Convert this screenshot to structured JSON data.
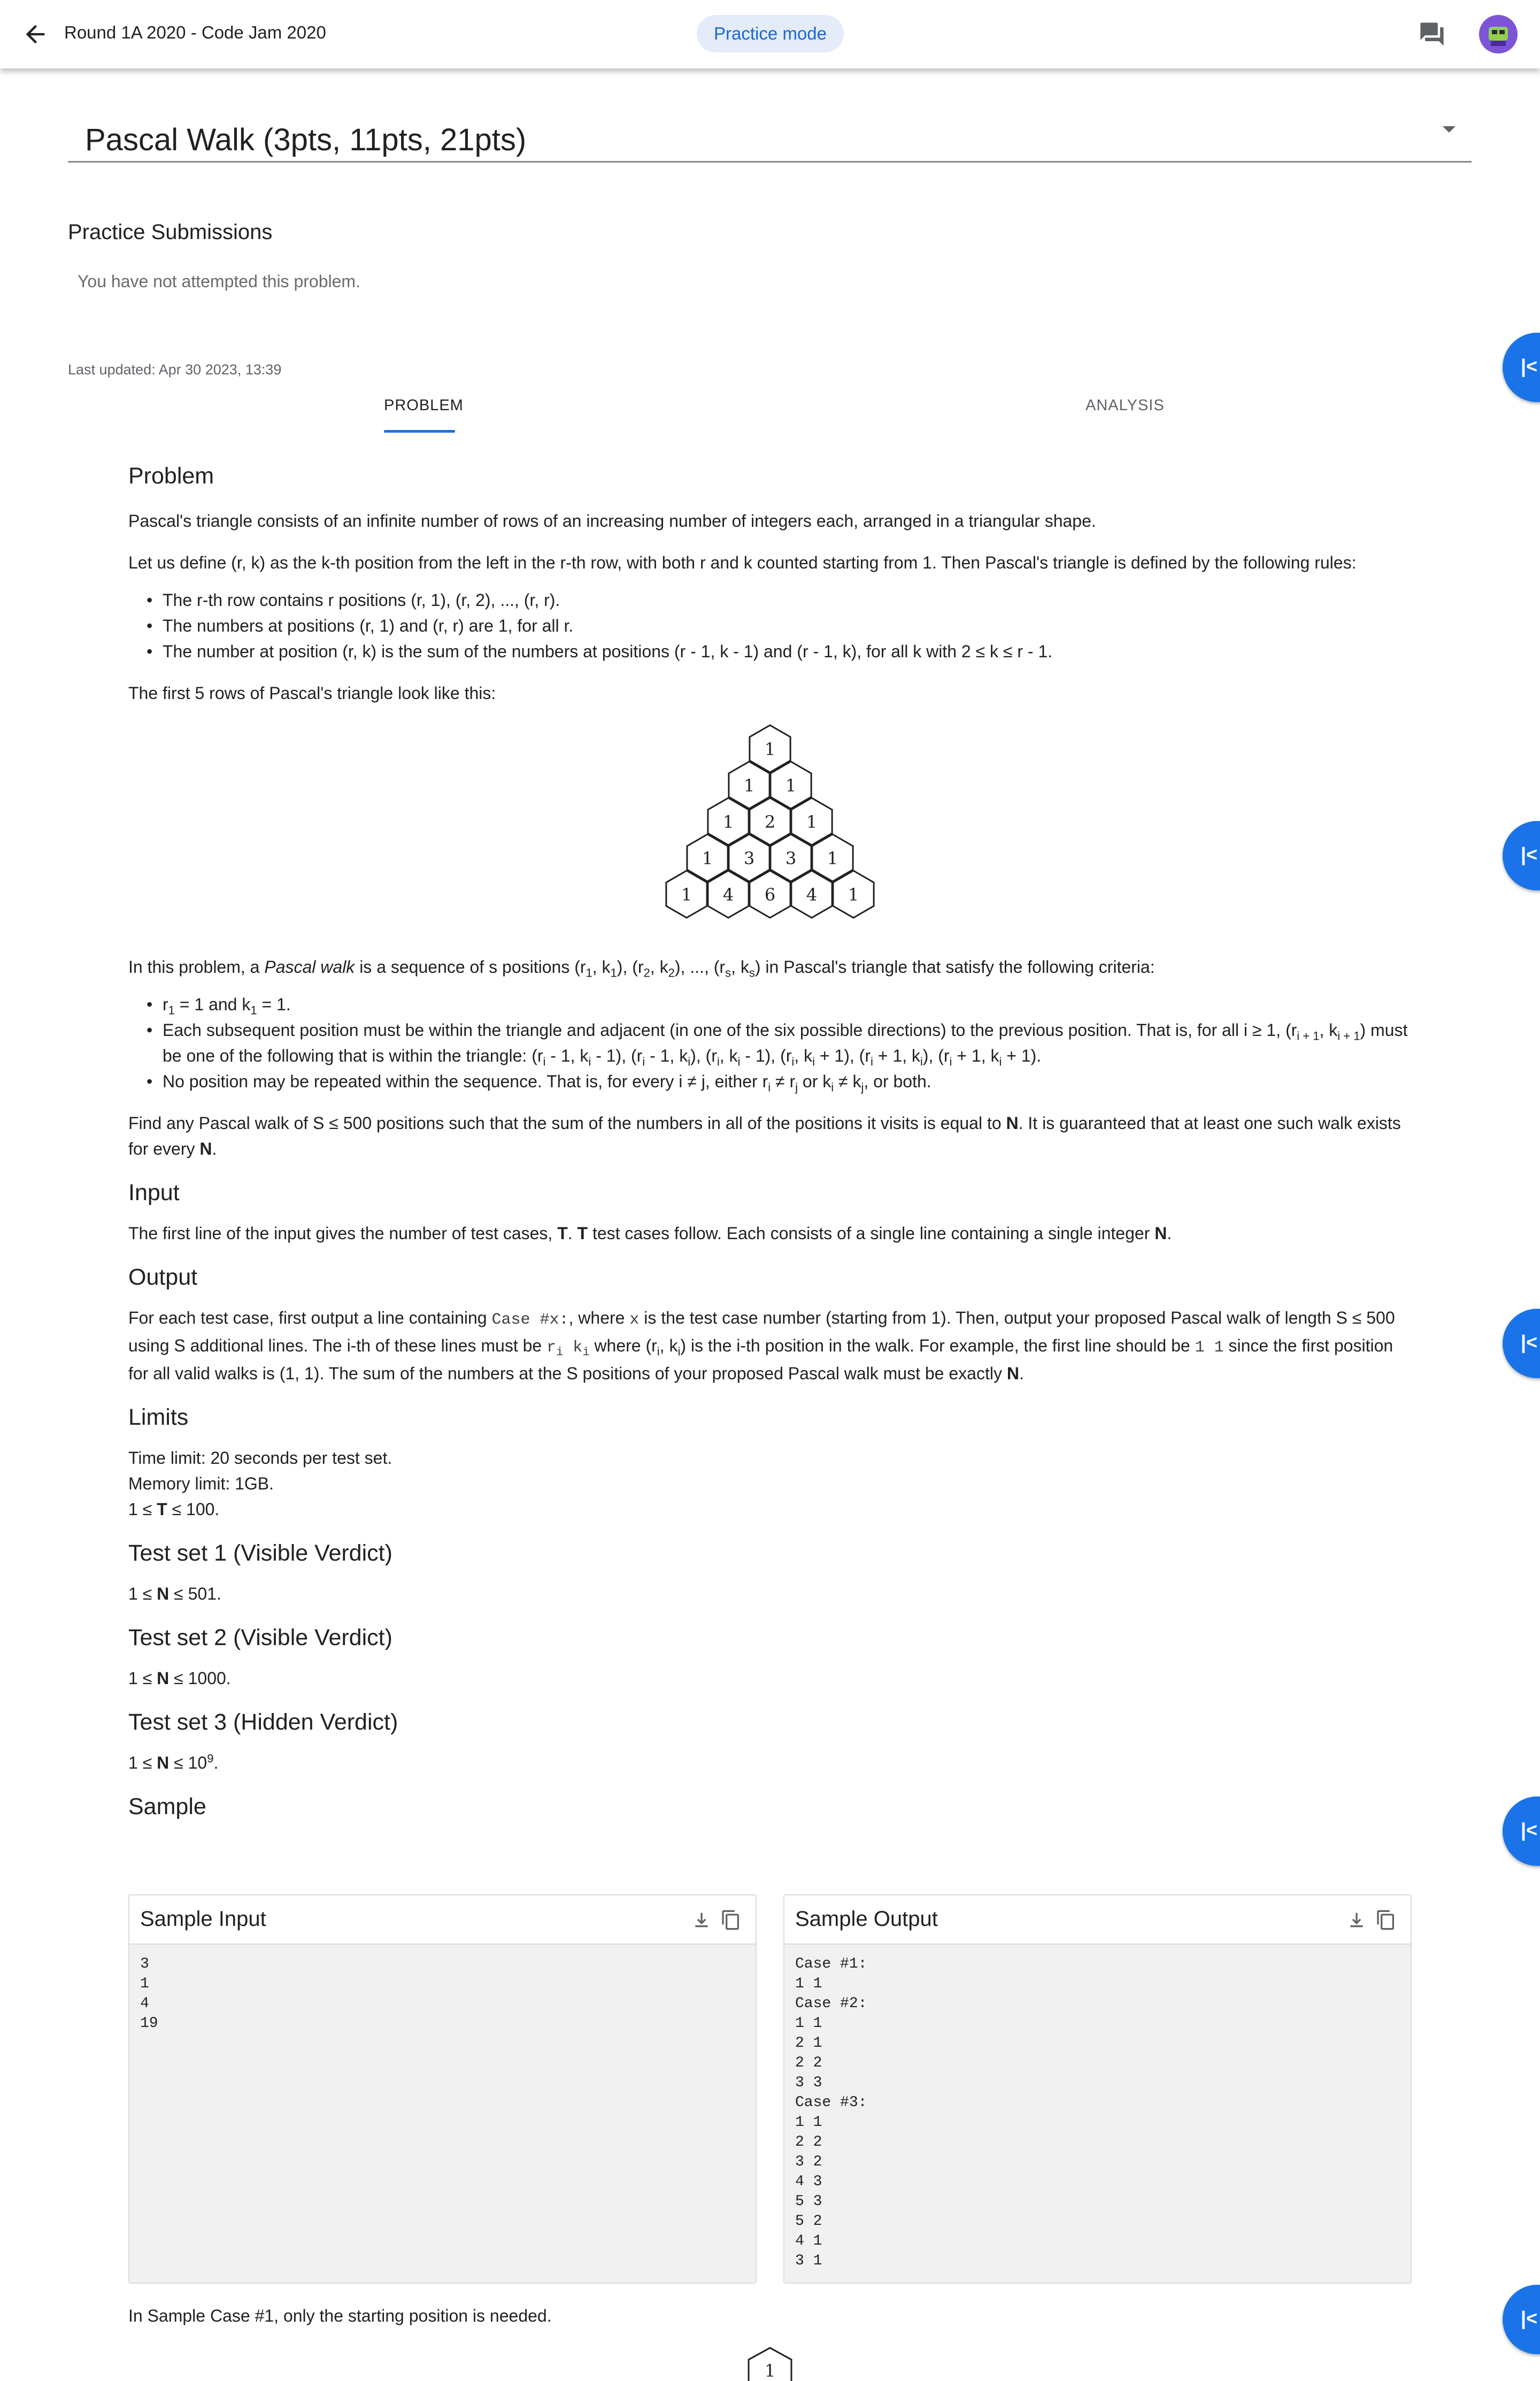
{
  "topbar": {
    "title": "Round 1A 2020 - Code Jam 2020",
    "practice_chip": "Practice mode"
  },
  "problem": {
    "title": "Pascal Walk (3pts, 11pts, 21pts)"
  },
  "submissions": {
    "title": "Practice Submissions",
    "empty": "You have not attempted this problem."
  },
  "last_updated": "Last updated: Apr 30 2023, 13:39",
  "tabs": {
    "problem": "PROBLEM",
    "analysis": "ANALYSIS"
  },
  "statement": {
    "h_problem": "Problem",
    "intro": "Pascal's triangle consists of an infinite number of rows of an increasing number of integers each, arranged in a triangular shape.",
    "define": "Let us define (r, k) as the k-th position from the left in the r-th row, with both r and k counted starting from 1. Then Pascal's triangle is defined by the following rules:",
    "rule1": "The r-th row contains r positions (r, 1), (r, 2), ..., (r, r).",
    "rule2": "The numbers at positions (r, 1) and (r, r) are 1, for all r.",
    "rule3": "The number at position (r, k) is the sum of the numbers at positions (r - 1, k - 1) and (r - 1, k), for all k with 2 ≤ k ≤ r - 1.",
    "first5": "The first 5 rows of Pascal's triangle look like this:",
    "triangle_rows": [
      [
        "1"
      ],
      [
        "1",
        "1"
      ],
      [
        "1",
        "2",
        "1"
      ],
      [
        "1",
        "3",
        "3",
        "1"
      ],
      [
        "1",
        "4",
        "6",
        "4",
        "1"
      ]
    ],
    "find": "Find any Pascal walk of S ≤ 500 positions such that the sum of the numbers in all of the positions it visits is equal to",
    "find_tail": ". It is guaranteed that at least one such walk exists for every",
    "h_input": "Input",
    "h_output": "Output",
    "h_limits": "Limits",
    "time_limit": "Time limit: 20 seconds per test set.",
    "memory_limit": "Memory limit: 1GB.",
    "h_ts1": "Test set 1 (Visible Verdict)",
    "h_ts2": "Test set 2 (Visible Verdict)",
    "h_ts3": "Test set 3 (Hidden Verdict)",
    "h_sample": "Sample"
  },
  "sample_input": {
    "title": "Sample Input",
    "body": "3\n1\n4\n19"
  },
  "sample_output": {
    "title": "Sample Output",
    "body": "Case #1:\n1 1\nCase #2:\n1 1\n2 1\n2 2\n3 3\nCase #3:\n1 1\n2 2\n3 2\n4 3\n5 3\n5 2\n4 1\n3 1"
  },
  "after_note": "In Sample Case #1, only the starting position is needed.",
  "bottom_hex_value": "1",
  "colors": {
    "accent": "#1a73e8",
    "chip_bg": "#e4ecf9",
    "chip_text": "#1967d2"
  }
}
